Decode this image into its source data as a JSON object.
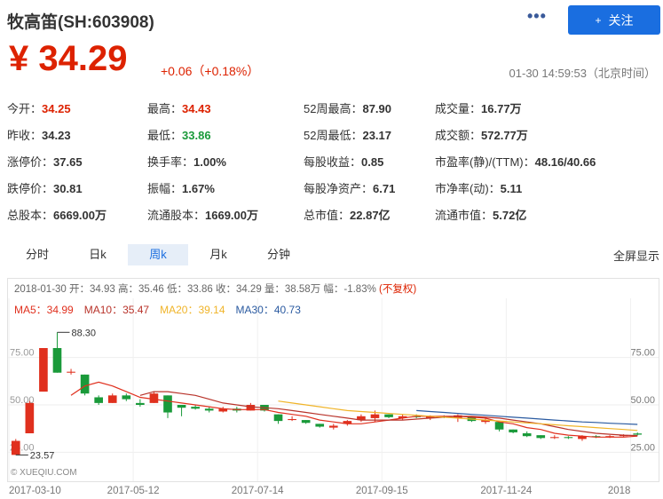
{
  "header": {
    "title": "牧高笛(SH:603908)",
    "follow_label": "关注",
    "follow_plus": "+"
  },
  "quote": {
    "price": "¥ 34.29",
    "change": "+0.06（+0.18%）",
    "timestamp": "01-30 14:59:53（北京时间）"
  },
  "stats": [
    [
      {
        "label": "今开：",
        "value": "34.25",
        "color": "red"
      },
      {
        "label": "最高：",
        "value": "34.43",
        "color": "red"
      },
      {
        "label": "52周最高：",
        "value": "87.90",
        "color": ""
      },
      {
        "label": "成交量：",
        "value": "16.77万",
        "color": ""
      }
    ],
    [
      {
        "label": "昨收：",
        "value": "34.23",
        "color": ""
      },
      {
        "label": "最低：",
        "value": "33.86",
        "color": "green"
      },
      {
        "label": "52周最低：",
        "value": "23.17",
        "color": ""
      },
      {
        "label": "成交额：",
        "value": "572.77万",
        "color": ""
      }
    ],
    [
      {
        "label": "涨停价：",
        "value": "37.65",
        "color": ""
      },
      {
        "label": "换手率：",
        "value": "1.00%",
        "color": ""
      },
      {
        "label": "每股收益：",
        "value": "0.85",
        "color": ""
      },
      {
        "label": "市盈率(静)/(TTM)：",
        "value": "48.16/40.66",
        "color": ""
      }
    ],
    [
      {
        "label": "跌停价：",
        "value": "30.81",
        "color": ""
      },
      {
        "label": "振幅：",
        "value": "1.67%",
        "color": ""
      },
      {
        "label": "每股净资产：",
        "value": "6.71",
        "color": ""
      },
      {
        "label": "市净率(动)：",
        "value": "5.11",
        "color": ""
      }
    ],
    [
      {
        "label": "总股本：",
        "value": "6669.00万",
        "color": ""
      },
      {
        "label": "流通股本：",
        "value": "1669.00万",
        "color": ""
      },
      {
        "label": "总市值：",
        "value": "22.87亿",
        "color": ""
      },
      {
        "label": "流通市值：",
        "value": "5.72亿",
        "color": ""
      }
    ]
  ],
  "tabs": {
    "items": [
      "分时",
      "日k",
      "周k",
      "月k",
      "分钟"
    ],
    "active": "周k",
    "fullscreen": "全屏显示"
  },
  "chart_info": {
    "ohlc_line": "2018-01-30 开：34.93 高：35.46 低：33.86 收：34.29 量：38.58万 幅：-1.83%",
    "adjust_label": "(不复权)",
    "ma": [
      {
        "label": "MA5：34.99",
        "color": "#e0301e"
      },
      {
        "label": "MA10：35.47",
        "color": "#b8332a"
      },
      {
        "label": "MA20：39.14",
        "color": "#f0b429"
      },
      {
        "label": "MA30：40.73",
        "color": "#2a5aa0"
      }
    ],
    "watermark": "© XUEQIU.COM",
    "colors": {
      "up": "#e0301e",
      "down": "#1a9a3a"
    }
  },
  "chart_data": {
    "type": "candlestick",
    "y_ticks": [
      "75.00",
      "50.00",
      "25.00"
    ],
    "y_tick_values": [
      75,
      50,
      25
    ],
    "ylim": [
      20,
      95
    ],
    "x_ticks": [
      "2017-03-10",
      "2017-05-12",
      "2017-07-14",
      "2017-09-15",
      "2017-11-24",
      "2018"
    ],
    "x_tick_index": [
      0,
      9,
      18,
      27,
      36,
      45
    ],
    "annotations": [
      {
        "text": "88.30",
        "index": 3,
        "value": 88.3
      },
      {
        "text": "23.57",
        "index": 0,
        "value": 23.57
      }
    ],
    "candles": [
      {
        "o": 23.6,
        "h": 32,
        "l": 23.57,
        "c": 31
      },
      {
        "o": 35,
        "h": 52,
        "l": 35,
        "c": 51
      },
      {
        "o": 57,
        "h": 80,
        "l": 57,
        "c": 80
      },
      {
        "o": 80,
        "h": 88.3,
        "l": 67,
        "c": 67
      },
      {
        "o": 67,
        "h": 69,
        "l": 66,
        "c": 67.5
      },
      {
        "o": 66,
        "h": 66,
        "l": 55,
        "c": 56
      },
      {
        "o": 54,
        "h": 55,
        "l": 50,
        "c": 51
      },
      {
        "o": 51,
        "h": 56,
        "l": 51,
        "c": 55
      },
      {
        "o": 55,
        "h": 56,
        "l": 52,
        "c": 53
      },
      {
        "o": 51,
        "h": 53,
        "l": 49,
        "c": 50
      },
      {
        "o": 51,
        "h": 57,
        "l": 51,
        "c": 56
      },
      {
        "o": 55,
        "h": 55,
        "l": 43,
        "c": 46
      },
      {
        "o": 50,
        "h": 50,
        "l": 44,
        "c": 48.5
      },
      {
        "o": 49,
        "h": 50,
        "l": 47.5,
        "c": 48
      },
      {
        "o": 48,
        "h": 49,
        "l": 46,
        "c": 47
      },
      {
        "o": 46.5,
        "h": 49,
        "l": 46,
        "c": 48
      },
      {
        "o": 48,
        "h": 49,
        "l": 46,
        "c": 47
      },
      {
        "o": 47,
        "h": 51,
        "l": 47,
        "c": 50
      },
      {
        "o": 50,
        "h": 50,
        "l": 46.5,
        "c": 47
      },
      {
        "o": 45,
        "h": 45,
        "l": 40,
        "c": 41.5
      },
      {
        "o": 42,
        "h": 44,
        "l": 41.5,
        "c": 42.5
      },
      {
        "o": 42,
        "h": 42,
        "l": 40,
        "c": 40.5
      },
      {
        "o": 40,
        "h": 40,
        "l": 38,
        "c": 38.5
      },
      {
        "o": 38,
        "h": 40,
        "l": 37,
        "c": 39
      },
      {
        "o": 40,
        "h": 42,
        "l": 39,
        "c": 41.5
      },
      {
        "o": 42,
        "h": 45,
        "l": 41,
        "c": 44
      },
      {
        "o": 43,
        "h": 47,
        "l": 41,
        "c": 45
      },
      {
        "o": 45,
        "h": 45,
        "l": 43,
        "c": 43.5
      },
      {
        "o": 43,
        "h": 45,
        "l": 42,
        "c": 44
      },
      {
        "o": 44,
        "h": 45,
        "l": 43,
        "c": 43.5
      },
      {
        "o": 43,
        "h": 44.5,
        "l": 42,
        "c": 44
      },
      {
        "o": 44,
        "h": 44.5,
        "l": 43,
        "c": 43.5
      },
      {
        "o": 43,
        "h": 45,
        "l": 41,
        "c": 44.5
      },
      {
        "o": 44,
        "h": 44,
        "l": 41,
        "c": 41.5
      },
      {
        "o": 41,
        "h": 43,
        "l": 40,
        "c": 42
      },
      {
        "o": 41,
        "h": 41,
        "l": 36,
        "c": 37
      },
      {
        "o": 37,
        "h": 37,
        "l": 35,
        "c": 35.5
      },
      {
        "o": 35,
        "h": 36,
        "l": 33,
        "c": 33.5
      },
      {
        "o": 34,
        "h": 34,
        "l": 32,
        "c": 32.5
      },
      {
        "o": 32.5,
        "h": 34,
        "l": 32,
        "c": 33
      },
      {
        "o": 33,
        "h": 33.5,
        "l": 32,
        "c": 32.5
      },
      {
        "o": 32,
        "h": 34,
        "l": 31,
        "c": 33.5
      },
      {
        "o": 33.5,
        "h": 34,
        "l": 32.5,
        "c": 33
      },
      {
        "o": 33,
        "h": 34,
        "l": 32.5,
        "c": 33.5
      },
      {
        "o": 33.5,
        "h": 34.5,
        "l": 33,
        "c": 34
      },
      {
        "o": 34.9,
        "h": 35.46,
        "l": 33.86,
        "c": 34.29
      }
    ],
    "ma_series": [
      {
        "name": "MA5",
        "values": [
          null,
          null,
          null,
          null,
          55,
          60,
          62,
          60,
          57,
          54,
          53,
          52,
          51,
          50,
          49,
          48,
          47.5,
          47.5,
          47.5,
          46,
          45,
          44,
          42,
          41,
          40,
          40,
          41,
          42,
          43,
          44,
          44,
          44,
          44,
          43.5,
          43,
          41,
          40,
          38,
          37,
          35,
          34,
          33.5,
          33,
          33,
          33,
          33.5
        ]
      },
      {
        "name": "MA10",
        "values": [
          null,
          null,
          null,
          null,
          null,
          null,
          null,
          null,
          null,
          55,
          57,
          57,
          56,
          55,
          53,
          51,
          50,
          49,
          48.5,
          48,
          47,
          46,
          45,
          44,
          43,
          42,
          42,
          42,
          42,
          42.5,
          43,
          43.5,
          44,
          44,
          43.5,
          43,
          42,
          41,
          40,
          38.5,
          37,
          36,
          35,
          34.5,
          34,
          33.8
        ]
      },
      {
        "name": "MA20",
        "values": [
          null,
          null,
          null,
          null,
          null,
          null,
          null,
          null,
          null,
          null,
          null,
          null,
          null,
          null,
          null,
          null,
          null,
          null,
          null,
          52,
          51,
          50,
          49,
          48,
          47,
          46.5,
          46,
          45.5,
          45,
          44.5,
          44,
          43.5,
          43,
          42.5,
          42,
          41.5,
          41,
          40.5,
          40,
          39.5,
          39,
          38.5,
          38,
          37.5,
          37,
          36.5
        ]
      },
      {
        "name": "MA30",
        "values": [
          null,
          null,
          null,
          null,
          null,
          null,
          null,
          null,
          null,
          null,
          null,
          null,
          null,
          null,
          null,
          null,
          null,
          null,
          null,
          null,
          null,
          null,
          null,
          null,
          null,
          null,
          null,
          null,
          null,
          47,
          46.5,
          46,
          45.5,
          45,
          44.5,
          44,
          43.5,
          43,
          42.5,
          42,
          41.5,
          41,
          40.7,
          40.3,
          40,
          39.7
        ]
      }
    ]
  }
}
